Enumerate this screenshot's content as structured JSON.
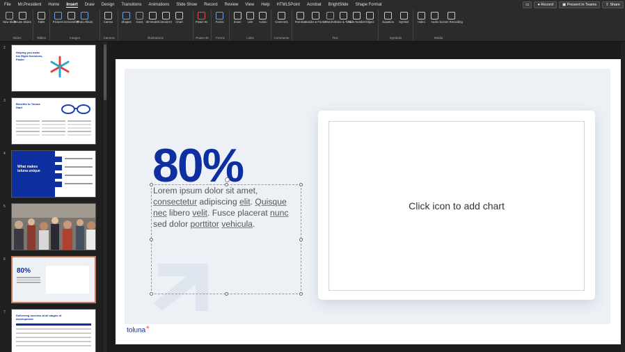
{
  "menu": {
    "tabs": [
      "File",
      "Mr.President",
      "Home",
      "Insert",
      "Draw",
      "Design",
      "Transitions",
      "Animations",
      "Slide Show",
      "Record",
      "Review",
      "View",
      "Help",
      "HTML5Point",
      "Acrobat",
      "BrightSlide",
      "Shape Format"
    ],
    "active_tab": "Insert",
    "record_label": "Record",
    "present_teams_label": "Present in Teams",
    "share_label": "Share"
  },
  "ribbon": {
    "groups": [
      {
        "name": "Slides",
        "buttons": [
          "New Slide",
          "Reuse Slides"
        ]
      },
      {
        "name": "Tables",
        "buttons": [
          "Table"
        ]
      },
      {
        "name": "Images",
        "buttons": [
          "Pictures",
          "Screenshot",
          "Photo Album"
        ]
      },
      {
        "name": "Camera",
        "buttons": [
          "Cameo"
        ]
      },
      {
        "name": "Illustrations",
        "buttons": [
          "Shapes",
          "Icons",
          "3D Models",
          "SmartArt",
          "Chart"
        ]
      },
      {
        "name": "Power BI",
        "buttons": [
          "Power BI"
        ]
      },
      {
        "name": "Forms",
        "buttons": [
          "Forms"
        ]
      },
      {
        "name": "Links",
        "buttons": [
          "Zoom",
          "Link",
          "Action"
        ]
      },
      {
        "name": "Comments",
        "buttons": [
          "Comment"
        ]
      },
      {
        "name": "Text",
        "buttons": [
          "Text Box",
          "Header & Footer",
          "WordArt",
          "Date & Time",
          "Slide Number",
          "Object"
        ]
      },
      {
        "name": "Symbols",
        "buttons": [
          "Equation",
          "Symbol"
        ]
      },
      {
        "name": "Media",
        "buttons": [
          "Video",
          "Audio",
          "Screen Recording"
        ]
      }
    ]
  },
  "thumbnails": [
    {
      "number": "2",
      "title": "Helping you make the Right Decisions, Faster"
    },
    {
      "number": "3",
      "title": "Benefits to Toluna Start"
    },
    {
      "number": "4",
      "title": "What makes toluna unique"
    },
    {
      "number": "5",
      "title": ""
    },
    {
      "number": "6",
      "title": "80%",
      "selected": true
    },
    {
      "number": "7",
      "title": "Delivering success at all stages of development"
    }
  ],
  "slide": {
    "big_number": "80%",
    "body_parts": [
      "Lorem ipsum dolor sit amet, ",
      "consectetur",
      " adipiscing ",
      "elit",
      ". ",
      "Quisque",
      " ",
      "nec",
      " libero ",
      "velit",
      ". Fusce placerat ",
      "nunc",
      " sed dolor ",
      "porttitor",
      " ",
      "vehicula",
      "."
    ],
    "chart_placeholder": "Click icon to add chart",
    "logo": "toluna"
  },
  "colors": {
    "brand_blue": "#0d2f9f",
    "accent_red": "#e04040",
    "slide_bg": "#edf1f6",
    "selection": "#c77a5a"
  }
}
